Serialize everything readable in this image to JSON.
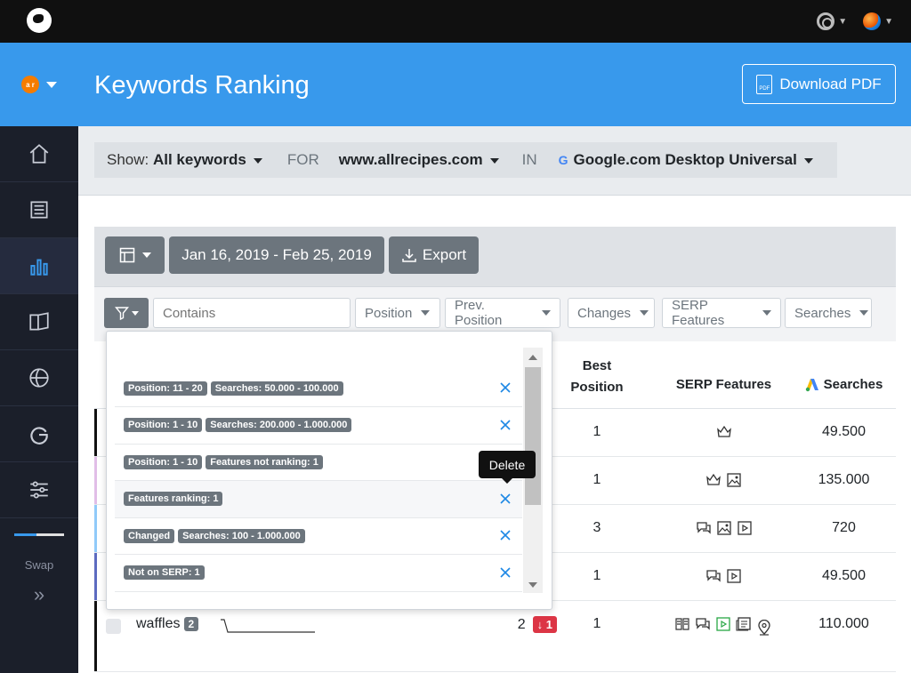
{
  "header": {
    "title": "Keywords Ranking",
    "download_label": "Download PDF",
    "pdf_icon_text": "PDF"
  },
  "brand": {
    "badge_text": "a r"
  },
  "sidebar": {
    "swap_label": "Swap",
    "expand_glyph": "»",
    "progress": 0.45
  },
  "filterbar": {
    "show_label": "Show:",
    "show_value": "All keywords",
    "for_label": "FOR",
    "domain": "www.allrecipes.com",
    "in_label": "IN",
    "engine_letter": "G",
    "engine": "Google.com Desktop Universal"
  },
  "toolbar": {
    "date_range": "Jan 16, 2019 - Feb 25, 2019",
    "export_label": "Export"
  },
  "filters": {
    "contains_placeholder": "Contains",
    "position": "Position",
    "prev_position": "Prev. Position",
    "changes": "Changes",
    "serp_features": "SERP Features",
    "searches": "Searches"
  },
  "columns": {
    "best_position_1": "Best",
    "best_position_2": "Position",
    "serp_features": "SERP Features",
    "searches": "Searches"
  },
  "saved_filters": [
    {
      "chips": [
        "Position: 11 - 20",
        "Searches: 50.000 - 100.000"
      ]
    },
    {
      "chips": [
        "Position: 1 - 10",
        "Searches: 200.000 - 1.000.000"
      ]
    },
    {
      "chips": [
        "Position: 1 - 10",
        "Features not ranking: 1"
      ]
    },
    {
      "chips": [
        "Features ranking: 1"
      ]
    },
    {
      "chips": [
        "Changed",
        "Searches: 100 - 1.000.000"
      ]
    },
    {
      "chips": [
        "Not on SERP: 1"
      ]
    }
  ],
  "tooltip": "Delete",
  "rows": [
    {
      "best": "1",
      "searches": "49.500",
      "serp": [
        "crown-icon"
      ],
      "mark": "#111"
    },
    {
      "best": "1",
      "searches": "135.000",
      "serp": [
        "crown-icon",
        "image-icon"
      ],
      "mark": "#e1bee7"
    },
    {
      "best": "3",
      "searches": "720",
      "serp": [
        "review-icon",
        "image-icon",
        "video-icon"
      ],
      "mark": "#90caf9"
    },
    {
      "best": "1",
      "searches": "49.500",
      "serp": [
        "review-icon",
        "video-icon"
      ],
      "mark": "#5c6bc0"
    },
    {
      "keyword": "waffles",
      "count": "2",
      "position": "2",
      "change": "↓ 1",
      "best": "1",
      "searches": "110.000",
      "serp": [
        "book-icon",
        "review-icon",
        "video-icon",
        "news-icon",
        "map-pin-icon"
      ],
      "mark": "#111"
    }
  ],
  "colors": {
    "accent": "#3899ec",
    "sidebar": "#1b1f2a",
    "chip": "#6c757d",
    "danger": "#dc3545",
    "x_blue": "#1e88e5"
  }
}
